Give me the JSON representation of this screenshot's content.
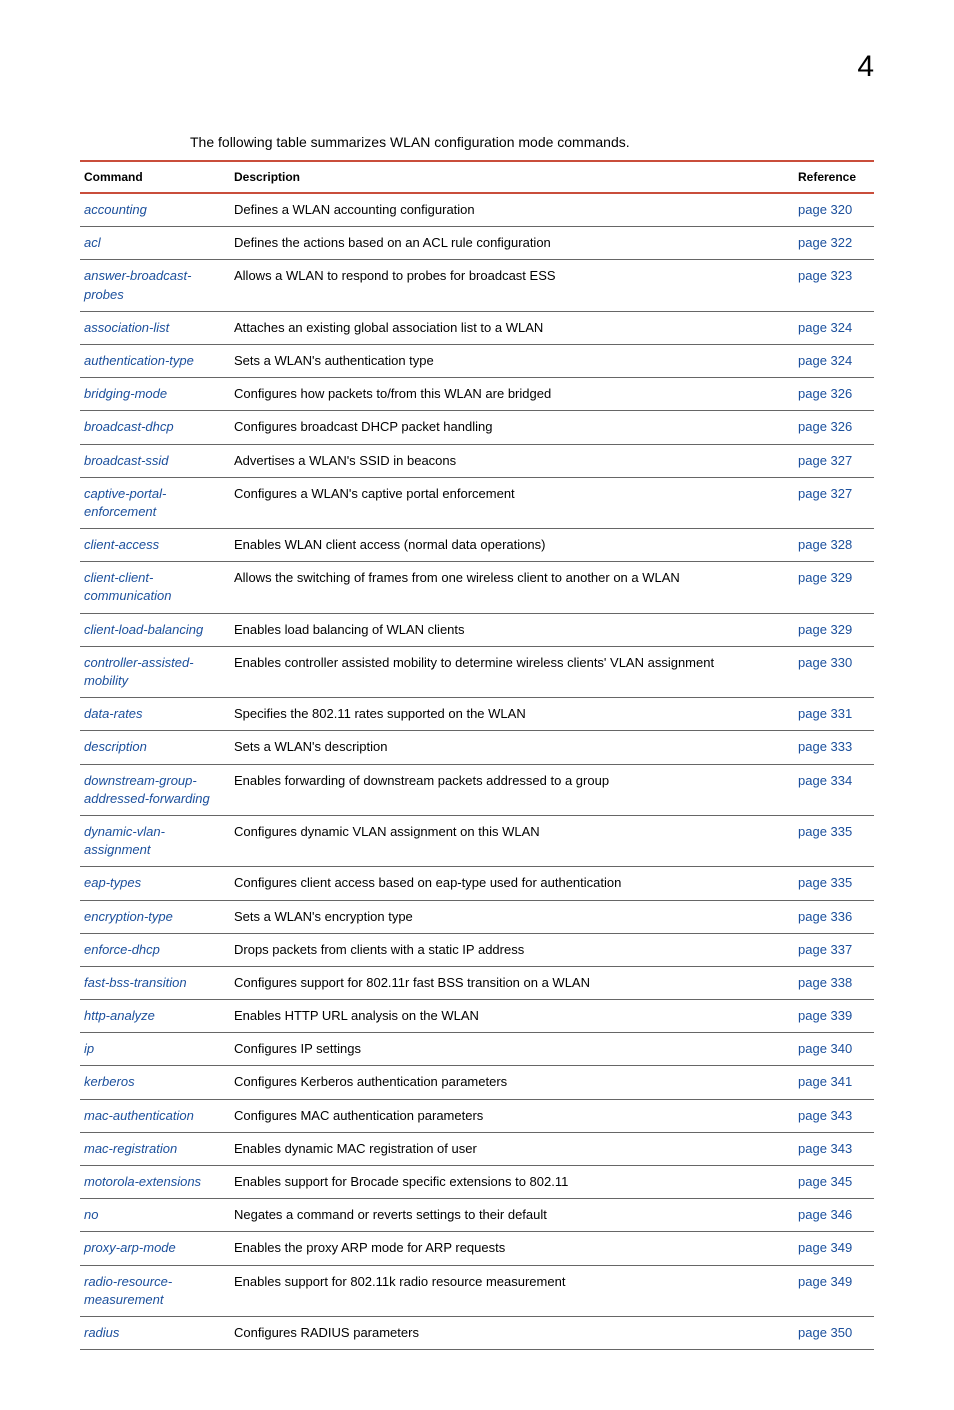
{
  "page_number": "4",
  "intro_text": "The following table summarizes WLAN configuration mode commands.",
  "headers": {
    "command": "Command",
    "description": "Description",
    "reference": "Reference"
  },
  "rows": [
    {
      "command": "accounting",
      "description": "Defines a WLAN accounting configuration",
      "reference": "page 320"
    },
    {
      "command": "acl",
      "description": "Defines the actions based on an ACL rule configuration",
      "reference": "page 322"
    },
    {
      "command": "answer-broadcast-probes",
      "description": "Allows a WLAN to respond to probes for broadcast ESS",
      "reference": "page 323"
    },
    {
      "command": "association-list",
      "description": "Attaches an existing global association list to a WLAN",
      "reference": "page 324"
    },
    {
      "command": "authentication-type",
      "description": "Sets a WLAN's authentication type",
      "reference": "page 324"
    },
    {
      "command": "bridging-mode",
      "description": "Configures how packets to/from this WLAN are bridged",
      "reference": "page 326"
    },
    {
      "command": "broadcast-dhcp",
      "description": "Configures broadcast DHCP packet handling",
      "reference": "page 326"
    },
    {
      "command": "broadcast-ssid",
      "description": "Advertises a WLAN's SSID in beacons",
      "reference": "page 327"
    },
    {
      "command": "captive-portal-enforcement",
      "description": "Configures a WLAN's captive portal enforcement",
      "reference": "page 327"
    },
    {
      "command": "client-access",
      "description": "Enables WLAN client access (normal data operations)",
      "reference": "page 328"
    },
    {
      "command": "client-client-communication",
      "description": "Allows the switching of frames from one wireless client to another on a WLAN",
      "reference": "page 329"
    },
    {
      "command": "client-load-balancing",
      "description": "Enables load balancing of WLAN clients",
      "reference": "page 329"
    },
    {
      "command": "controller-assisted-mobility",
      "description": "Enables controller assisted mobility to determine wireless clients' VLAN assignment",
      "reference": "page 330"
    },
    {
      "command": "data-rates",
      "description": "Specifies the 802.11 rates supported on the WLAN",
      "reference": "page 331"
    },
    {
      "command": "description",
      "description": "Sets a WLAN's description",
      "reference": "page 333"
    },
    {
      "command": "downstream-group-addressed-forwarding",
      "description": "Enables forwarding of downstream packets addressed to a group",
      "reference": "page 334"
    },
    {
      "command": "dynamic-vlan-assignment",
      "description": "Configures dynamic VLAN assignment on this WLAN",
      "reference": "page 335"
    },
    {
      "command": "eap-types",
      "description": "Configures client access based on eap-type used for authentication",
      "reference": "page 335"
    },
    {
      "command": "encryption-type",
      "description": "Sets a WLAN's encryption type",
      "reference": "page 336"
    },
    {
      "command": "enforce-dhcp",
      "description": "Drops packets from clients with a static IP address",
      "reference": "page 337"
    },
    {
      "command": "fast-bss-transition",
      "description": "Configures support for 802.11r fast BSS transition on a WLAN",
      "reference": "page 338"
    },
    {
      "command": "http-analyze",
      "description": "Enables HTTP URL analysis on the WLAN",
      "reference": "page 339"
    },
    {
      "command": "ip",
      "description": "Configures IP settings",
      "reference": "page 340"
    },
    {
      "command": "kerberos",
      "description": "Configures Kerberos authentication parameters",
      "reference": "page 341"
    },
    {
      "command": "mac-authentication",
      "description": "Configures MAC authentication parameters",
      "reference": "page 343"
    },
    {
      "command": "mac-registration",
      "description": "Enables dynamic MAC registration of user",
      "reference": "page 343"
    },
    {
      "command": "motorola-extensions",
      "description": "Enables support for Brocade specific extensions to 802.11",
      "reference": "page 345"
    },
    {
      "command": "no",
      "description": "Negates a command or reverts settings to their default",
      "reference": "page 346"
    },
    {
      "command": "proxy-arp-mode",
      "description": "Enables the proxy ARP mode for ARP requests",
      "reference": "page 349"
    },
    {
      "command": "radio-resource-measurement",
      "description": "Enables support for 802.11k radio resource measurement",
      "reference": "page 349"
    },
    {
      "command": "radius",
      "description": "Configures RADIUS parameters",
      "reference": "page 350"
    }
  ]
}
